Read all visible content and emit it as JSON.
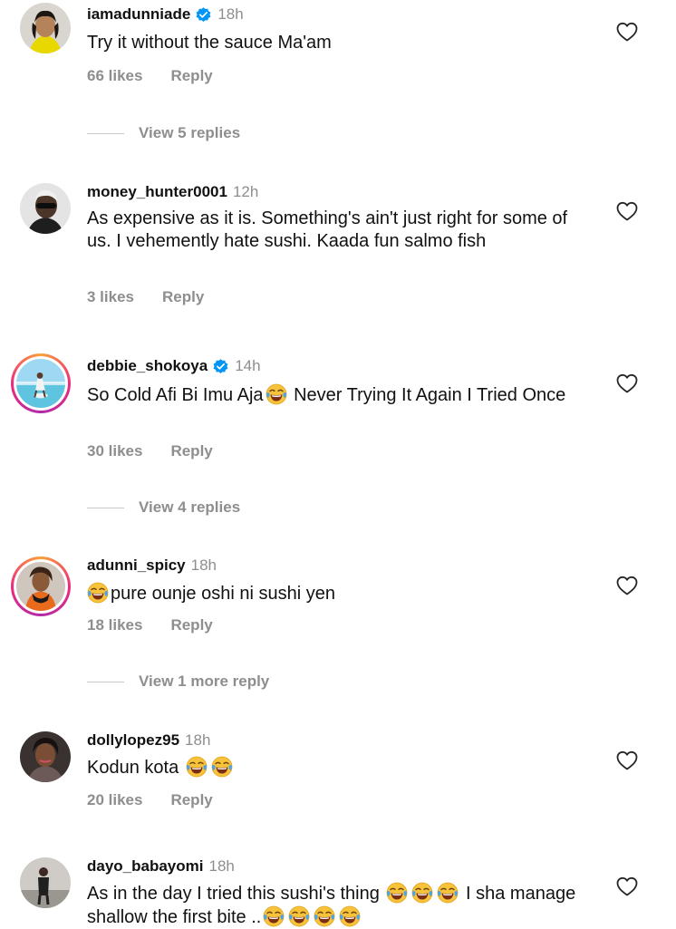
{
  "comments": [
    {
      "username": "iamadunniade",
      "verified": true,
      "time": "18h",
      "text": "Try it without the sauce Ma'am",
      "likes": "66 likes",
      "reply": "Reply",
      "view_replies": "View 5 replies"
    },
    {
      "username": "money_hunter0001",
      "verified": false,
      "time": "12h",
      "text": "As expensive as it is. Something's ain't just right for some of us. I vehemently hate sushi. Kaada fun salmo fish",
      "likes": "3 likes",
      "reply": "Reply"
    },
    {
      "username": "debbie_shokoya",
      "verified": true,
      "time": "14h",
      "text_before": "So Cold Afi Bi Imu Aja",
      "text_after": " Never Trying It Again I Tried Once",
      "likes": "30 likes",
      "reply": "Reply",
      "view_replies": "View 4 replies"
    },
    {
      "username": "adunni_spicy",
      "verified": false,
      "time": "18h",
      "text_after": "pure ounje oshi ni sushi yen",
      "likes": "18 likes",
      "reply": "Reply",
      "view_replies": "View 1 more reply"
    },
    {
      "username": "dollylopez95",
      "verified": false,
      "time": "18h",
      "text_before": "Kodun kota ",
      "likes": "20 likes",
      "reply": "Reply"
    },
    {
      "username": "dayo_babayomi",
      "verified": false,
      "time": "18h",
      "text_before": "As in the day I tried this sushi's thing ",
      "text_mid": " I sha manage shallow the first bite ..",
      "text_after": ""
    }
  ],
  "icons": {
    "heart": "heart-outline-icon",
    "verified": "verified-badge-icon",
    "emoji": "face-with-tears-of-joy-emoji"
  },
  "colors": {
    "verified_blue": "#0095f6",
    "muted_text": "#8e8e8e",
    "story_ring": "#ee2a7b"
  }
}
